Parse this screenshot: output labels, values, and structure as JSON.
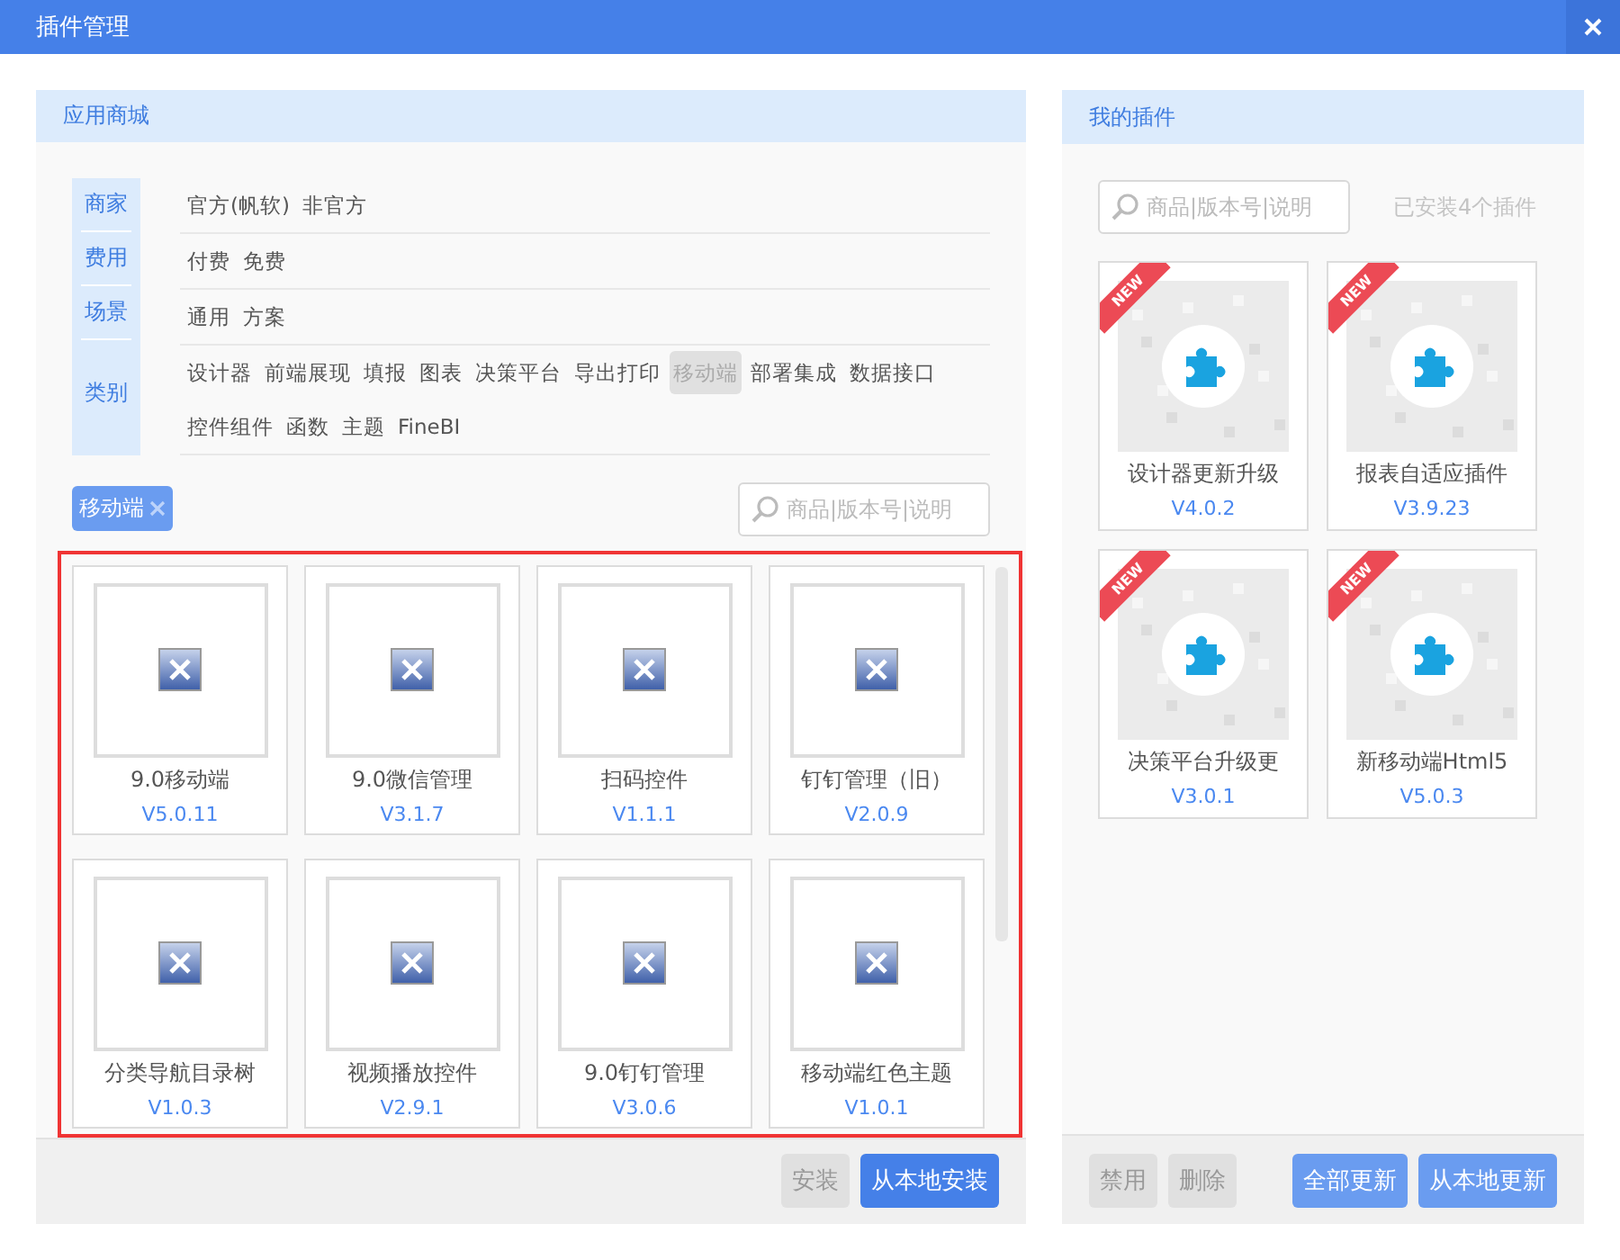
{
  "window": {
    "title": "插件管理"
  },
  "store": {
    "title": "应用商城",
    "filters": [
      {
        "label": "商家",
        "options": [
          {
            "label": "官方(帆软)",
            "selected": false
          },
          {
            "label": "非官方",
            "selected": false
          }
        ]
      },
      {
        "label": "费用",
        "options": [
          {
            "label": "付费",
            "selected": false
          },
          {
            "label": "免费",
            "selected": false
          }
        ]
      },
      {
        "label": "场景",
        "options": [
          {
            "label": "通用",
            "selected": false
          },
          {
            "label": "方案",
            "selected": false
          }
        ]
      },
      {
        "label": "类别",
        "options": [
          {
            "label": "设计器",
            "selected": false
          },
          {
            "label": "前端展现",
            "selected": false
          },
          {
            "label": "填报",
            "selected": false
          },
          {
            "label": "图表",
            "selected": false
          },
          {
            "label": "决策平台",
            "selected": false
          },
          {
            "label": "导出打印",
            "selected": false
          },
          {
            "label": "移动端",
            "selected": true
          },
          {
            "label": "部署集成",
            "selected": false
          },
          {
            "label": "数据接口",
            "selected": false
          },
          {
            "label": "控件组件",
            "selected": false
          },
          {
            "label": "函数",
            "selected": false
          },
          {
            "label": "主题",
            "selected": false
          },
          {
            "label": "FineBI",
            "selected": false
          }
        ]
      }
    ],
    "active_tags": [
      {
        "label": "移动端"
      }
    ],
    "search": {
      "placeholder": "商品|版本号|说明"
    },
    "plugins": [
      {
        "name": "9.0移动端",
        "version": "V5.0.11"
      },
      {
        "name": "9.0微信管理",
        "version": "V3.1.7"
      },
      {
        "name": "扫码控件",
        "version": "V1.1.1"
      },
      {
        "name": "钉钉管理（旧）",
        "version": "V2.0.9"
      },
      {
        "name": "分类导航目录树",
        "version": "V1.0.3"
      },
      {
        "name": "视频播放控件",
        "version": "V2.9.1"
      },
      {
        "name": "9.0钉钉管理",
        "version": "V3.0.6"
      },
      {
        "name": "移动端红色主题",
        "version": "V1.0.1"
      }
    ],
    "buttons": [
      {
        "label": "安装",
        "disabled": true
      },
      {
        "label": "从本地安装",
        "disabled": false
      }
    ]
  },
  "mine": {
    "title": "我的插件",
    "search": {
      "placeholder": "商品|版本号|说明"
    },
    "summary": "已安装4个插件",
    "plugins": [
      {
        "name": "设计器更新升级",
        "version": "V4.0.2",
        "badge": "NEW"
      },
      {
        "name": "报表自适应插件",
        "version": "V3.9.23",
        "badge": "NEW"
      },
      {
        "name": "决策平台升级更",
        "version": "V3.0.1",
        "badge": "NEW"
      },
      {
        "name": "新移动端Html5",
        "version": "V5.0.3",
        "badge": "NEW"
      }
    ],
    "buttons_start": [
      {
        "label": "禁用",
        "disabled": true
      },
      {
        "label": "删除",
        "disabled": true
      }
    ],
    "buttons_end": [
      {
        "label": "全部更新",
        "disabled": false
      },
      {
        "label": "从本地更新",
        "disabled": false
      }
    ]
  }
}
